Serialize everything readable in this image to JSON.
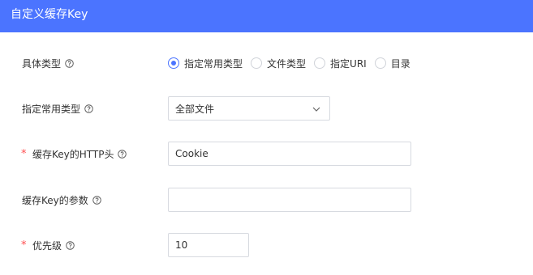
{
  "header": {
    "title": "自定义缓存Key"
  },
  "fields": {
    "type": {
      "label": "具体类型",
      "options": [
        {
          "label": "指定常用类型",
          "checked": true
        },
        {
          "label": "文件类型",
          "checked": false
        },
        {
          "label": "指定URI",
          "checked": false
        },
        {
          "label": "目录",
          "checked": false
        }
      ]
    },
    "common_type": {
      "label": "指定常用类型",
      "value": "全部文件"
    },
    "http_header": {
      "label": "缓存Key的HTTP头",
      "required_mark": "*",
      "value": "Cookie"
    },
    "params": {
      "label": "缓存Key的参数",
      "value": ""
    },
    "priority": {
      "label": "优先级",
      "required_mark": "*",
      "value": "10"
    }
  },
  "icons": {
    "help": "question-circle-icon",
    "select": "chevron-down-icon"
  },
  "colors": {
    "accent": "#4b74ff",
    "required": "#ff4d4f",
    "border": "#d7dae0",
    "text": "#333333"
  }
}
